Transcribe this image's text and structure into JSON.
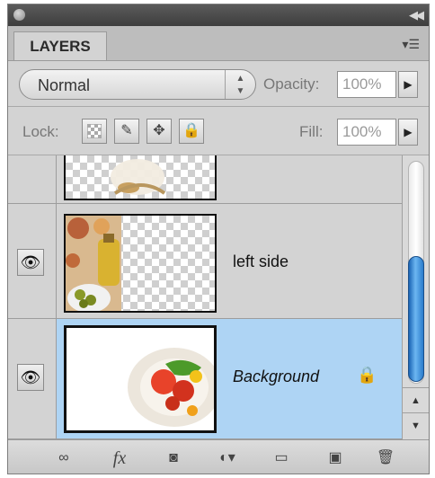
{
  "panel": {
    "tab_label": "LAYERS",
    "blend_mode": "Normal",
    "opacity_label": "Opacity:",
    "opacity_value": "100%",
    "lock_label": "Lock:",
    "fill_label": "Fill:",
    "fill_value": "100%"
  },
  "layers": [
    {
      "name": "",
      "visible": false,
      "selected": false
    },
    {
      "name": "left side",
      "visible": true,
      "selected": false
    },
    {
      "name": "Background",
      "visible": true,
      "selected": true,
      "locked": true
    }
  ],
  "icons": {
    "lock_transparent": "checker-icon",
    "lock_image": "brush-icon",
    "lock_position": "move-icon",
    "lock_all": "padlock-icon",
    "bottom": [
      "link-icon",
      "fx-icon",
      "mask-icon",
      "adjustment-icon",
      "folder-icon",
      "new-layer-icon",
      "trash-icon"
    ]
  },
  "colors": {
    "selection": "#aed4f4",
    "scroll_thumb": "#2a7ccc"
  }
}
